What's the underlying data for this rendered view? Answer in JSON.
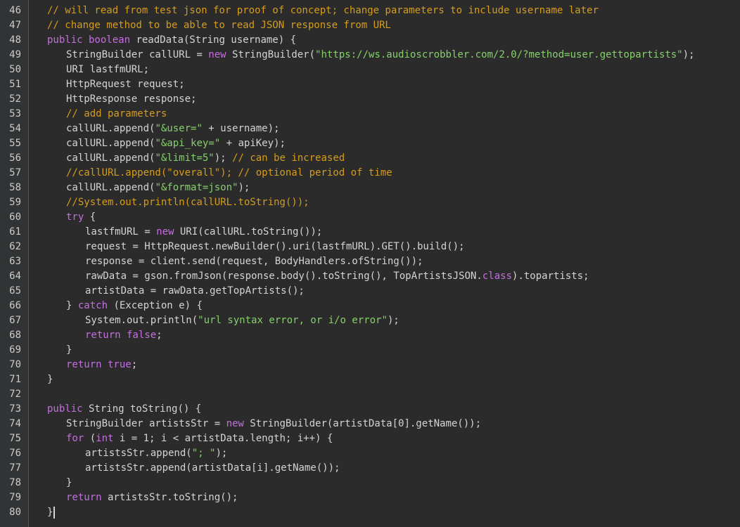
{
  "editor": {
    "colors": {
      "background": "#2b2b2b",
      "gutter": "#313335",
      "line_number": "#cccccc",
      "plain": "#d4d4d4",
      "comment": "#d69c1c",
      "keyword": "#c46fe0",
      "string": "#86d06b"
    },
    "lines": [
      {
        "num": "46",
        "indent": 1,
        "tokens": [
          {
            "t": "// will read from test json for proof of concept; change parameters to include username later",
            "k": "comment"
          }
        ]
      },
      {
        "num": "47",
        "indent": 1,
        "tokens": [
          {
            "t": "// change method to be able to read JSON response from URL",
            "k": "comment"
          }
        ]
      },
      {
        "num": "48",
        "indent": 1,
        "tokens": [
          {
            "t": "public boolean",
            "k": "keyword"
          },
          {
            "t": " readData(String username) {",
            "k": "plain"
          }
        ]
      },
      {
        "num": "49",
        "indent": 2,
        "tokens": [
          {
            "t": "StringBuilder callURL = ",
            "k": "plain"
          },
          {
            "t": "new",
            "k": "keyword"
          },
          {
            "t": " StringBuilder(",
            "k": "plain"
          },
          {
            "t": "\"https://ws.audioscrobbler.com/2.0/?method=user.gettopartists\"",
            "k": "string"
          },
          {
            "t": ");",
            "k": "plain"
          }
        ]
      },
      {
        "num": "50",
        "indent": 2,
        "tokens": [
          {
            "t": "URI lastfmURL;",
            "k": "plain"
          }
        ]
      },
      {
        "num": "51",
        "indent": 2,
        "tokens": [
          {
            "t": "HttpRequest request;",
            "k": "plain"
          }
        ]
      },
      {
        "num": "52",
        "indent": 2,
        "tokens": [
          {
            "t": "HttpResponse response;",
            "k": "plain"
          }
        ]
      },
      {
        "num": "53",
        "indent": 2,
        "tokens": [
          {
            "t": "// add parameters",
            "k": "comment"
          }
        ]
      },
      {
        "num": "54",
        "indent": 2,
        "tokens": [
          {
            "t": "callURL.append(",
            "k": "plain"
          },
          {
            "t": "\"&user=\"",
            "k": "string"
          },
          {
            "t": " + username);",
            "k": "plain"
          }
        ]
      },
      {
        "num": "55",
        "indent": 2,
        "tokens": [
          {
            "t": "callURL.append(",
            "k": "plain"
          },
          {
            "t": "\"&api_key=\"",
            "k": "string"
          },
          {
            "t": " + apiKey);",
            "k": "plain"
          }
        ]
      },
      {
        "num": "56",
        "indent": 2,
        "tokens": [
          {
            "t": "callURL.append(",
            "k": "plain"
          },
          {
            "t": "\"&limit=5\"",
            "k": "string"
          },
          {
            "t": "); ",
            "k": "plain"
          },
          {
            "t": "// can be increased",
            "k": "comment"
          }
        ]
      },
      {
        "num": "57",
        "indent": 2,
        "tokens": [
          {
            "t": "//callURL.append(\"overall\"); // optional period of time",
            "k": "comment"
          }
        ]
      },
      {
        "num": "58",
        "indent": 2,
        "tokens": [
          {
            "t": "callURL.append(",
            "k": "plain"
          },
          {
            "t": "\"&format=json\"",
            "k": "string"
          },
          {
            "t": ");",
            "k": "plain"
          }
        ]
      },
      {
        "num": "59",
        "indent": 2,
        "tokens": [
          {
            "t": "//System.out.println(callURL.toString());",
            "k": "comment"
          }
        ]
      },
      {
        "num": "60",
        "indent": 2,
        "tokens": [
          {
            "t": "try",
            "k": "keyword"
          },
          {
            "t": " {",
            "k": "plain"
          }
        ]
      },
      {
        "num": "61",
        "indent": 3,
        "tokens": [
          {
            "t": "lastfmURL = ",
            "k": "plain"
          },
          {
            "t": "new",
            "k": "keyword"
          },
          {
            "t": " URI(callURL.toString());",
            "k": "plain"
          }
        ]
      },
      {
        "num": "62",
        "indent": 3,
        "tokens": [
          {
            "t": "request = HttpRequest.newBuilder().uri(lastfmURL).GET().build();",
            "k": "plain"
          }
        ]
      },
      {
        "num": "63",
        "indent": 3,
        "tokens": [
          {
            "t": "response = client.send(request, BodyHandlers.ofString());",
            "k": "plain"
          }
        ]
      },
      {
        "num": "64",
        "indent": 3,
        "tokens": [
          {
            "t": "rawData = gson.fromJson(response.body().toString(), TopArtistsJSON.",
            "k": "plain"
          },
          {
            "t": "class",
            "k": "keyword"
          },
          {
            "t": ").topartists;",
            "k": "plain"
          }
        ]
      },
      {
        "num": "65",
        "indent": 3,
        "tokens": [
          {
            "t": "artistData = rawData.getTopArtists();",
            "k": "plain"
          }
        ]
      },
      {
        "num": "66",
        "indent": 2,
        "tokens": [
          {
            "t": "} ",
            "k": "plain"
          },
          {
            "t": "catch",
            "k": "keyword"
          },
          {
            "t": " (Exception e) {",
            "k": "plain"
          }
        ]
      },
      {
        "num": "67",
        "indent": 3,
        "tokens": [
          {
            "t": "System.out.println(",
            "k": "plain"
          },
          {
            "t": "\"url syntax error, or i/o error\"",
            "k": "string"
          },
          {
            "t": ");",
            "k": "plain"
          }
        ]
      },
      {
        "num": "68",
        "indent": 3,
        "tokens": [
          {
            "t": "return false",
            "k": "keyword"
          },
          {
            "t": ";",
            "k": "plain"
          }
        ]
      },
      {
        "num": "69",
        "indent": 2,
        "tokens": [
          {
            "t": "}",
            "k": "plain"
          }
        ]
      },
      {
        "num": "70",
        "indent": 2,
        "tokens": [
          {
            "t": "return true",
            "k": "keyword"
          },
          {
            "t": ";",
            "k": "plain"
          }
        ]
      },
      {
        "num": "71",
        "indent": 1,
        "tokens": [
          {
            "t": "}",
            "k": "plain"
          }
        ]
      },
      {
        "num": "72",
        "indent": 1,
        "tokens": []
      },
      {
        "num": "73",
        "indent": 1,
        "tokens": [
          {
            "t": "public",
            "k": "keyword"
          },
          {
            "t": " String toString() {",
            "k": "plain"
          }
        ]
      },
      {
        "num": "74",
        "indent": 2,
        "tokens": [
          {
            "t": "StringBuilder artistsStr = ",
            "k": "plain"
          },
          {
            "t": "new",
            "k": "keyword"
          },
          {
            "t": " StringBuilder(artistData[0].getName());",
            "k": "plain"
          }
        ]
      },
      {
        "num": "75",
        "indent": 2,
        "tokens": [
          {
            "t": "for",
            "k": "keyword"
          },
          {
            "t": " (",
            "k": "plain"
          },
          {
            "t": "int",
            "k": "keyword"
          },
          {
            "t": " i = 1; i < artistData.length; i++) {",
            "k": "plain"
          }
        ]
      },
      {
        "num": "76",
        "indent": 3,
        "tokens": [
          {
            "t": "artistsStr.append(",
            "k": "plain"
          },
          {
            "t": "\"; \"",
            "k": "string"
          },
          {
            "t": ");",
            "k": "plain"
          }
        ]
      },
      {
        "num": "77",
        "indent": 3,
        "tokens": [
          {
            "t": "artistsStr.append(artistData[i].getName());",
            "k": "plain"
          }
        ]
      },
      {
        "num": "78",
        "indent": 2,
        "tokens": [
          {
            "t": "}",
            "k": "plain"
          }
        ]
      },
      {
        "num": "79",
        "indent": 2,
        "tokens": [
          {
            "t": "return",
            "k": "keyword"
          },
          {
            "t": " artistsStr.toString();",
            "k": "plain"
          }
        ]
      },
      {
        "num": "80",
        "indent": 1,
        "tokens": [
          {
            "t": "}",
            "k": "plain"
          }
        ],
        "caret": true
      }
    ]
  }
}
